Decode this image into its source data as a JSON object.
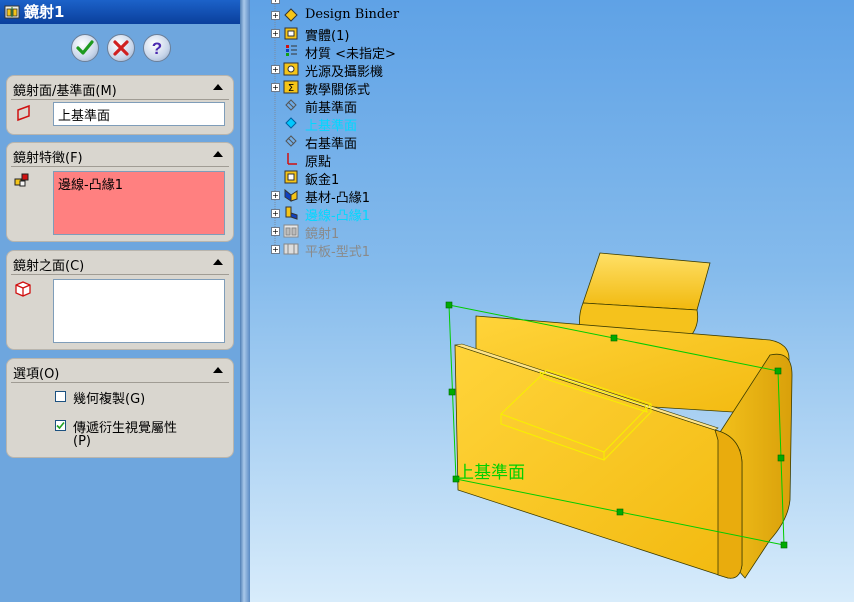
{
  "property_manager": {
    "title": "鏡射1",
    "ok_icon": "check-icon",
    "cancel_icon": "x-icon",
    "help_icon": "question-icon",
    "mirror_face": {
      "header": "鏡射面/基準面(M)",
      "value": "上基準面"
    },
    "features_to_mirror": {
      "header": "鏡射特徵(F)",
      "value": "邊線-凸緣1",
      "highlight_color": "#ff8080"
    },
    "faces_to_mirror": {
      "header": "鏡射之面(C)",
      "value": ""
    },
    "options": {
      "header": "選項(O)",
      "geometry_pattern": {
        "label": "幾何複製(G)",
        "checked": false
      },
      "propagate_visual": {
        "label": "傳遞衍生視覺屬性",
        "label2": "(P)",
        "checked": true
      }
    }
  },
  "feature_tree": [
    {
      "label": "Design Binder",
      "icon": "binder-icon",
      "expandable": true,
      "color": "#000000"
    },
    {
      "label": "實體(1)",
      "icon": "solid-bodies-icon",
      "expandable": true,
      "color": "#000000"
    },
    {
      "label": "材質 <未指定>",
      "icon": "material-icon",
      "expandable": false,
      "color": "#000000"
    },
    {
      "label": "光源及攝影機",
      "icon": "lights-icon",
      "expandable": true,
      "color": "#000000"
    },
    {
      "label": "數學關係式",
      "icon": "equations-icon",
      "expandable": true,
      "color": "#000000"
    },
    {
      "label": "前基準面",
      "icon": "plane-icon",
      "expandable": false,
      "color": "#000000"
    },
    {
      "label": "上基準面",
      "icon": "plane-selected-icon",
      "expandable": false,
      "color": "#00d8ff"
    },
    {
      "label": "右基準面",
      "icon": "plane-icon",
      "expandable": false,
      "color": "#000000"
    },
    {
      "label": "原點",
      "icon": "origin-icon",
      "expandable": false,
      "color": "#000000"
    },
    {
      "label": "鈑金1",
      "icon": "sheet-metal-icon",
      "expandable": false,
      "color": "#000000"
    },
    {
      "label": "基材-凸緣1",
      "icon": "base-flange-icon",
      "expandable": true,
      "color": "#000000"
    },
    {
      "label": "邊線-凸緣1",
      "icon": "edge-flange-icon",
      "expandable": true,
      "color": "#00d8ff"
    },
    {
      "label": "鏡射1",
      "icon": "mirror-icon",
      "expandable": true,
      "color": "#8a8a8a"
    },
    {
      "label": "平板-型式1",
      "icon": "flat-pattern-icon",
      "expandable": true,
      "color": "#8a8a8a"
    }
  ],
  "viewport": {
    "plane_label": "上基準面",
    "plane_color": "#00d000",
    "part_color": "#f5c518"
  }
}
